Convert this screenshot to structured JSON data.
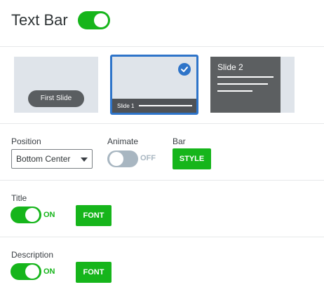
{
  "header": {
    "title": "Text Bar",
    "enabled": true
  },
  "slides": [
    {
      "pill_label": "First Slide"
    },
    {
      "bar_label": "Slide 1",
      "selected": true
    },
    {
      "title": "Slide 2"
    }
  ],
  "position": {
    "label": "Position",
    "value": "Bottom Center"
  },
  "animate": {
    "label": "Animate",
    "state": "OFF"
  },
  "bar": {
    "label": "Bar",
    "button": "STYLE"
  },
  "title_section": {
    "label": "Title",
    "state": "ON",
    "button": "FONT"
  },
  "description_section": {
    "label": "Description",
    "state": "ON",
    "button": "FONT"
  },
  "colors": {
    "accent_green": "#16b51b",
    "selection_blue": "#2e74c9",
    "toggle_off": "#a8b6c1"
  }
}
